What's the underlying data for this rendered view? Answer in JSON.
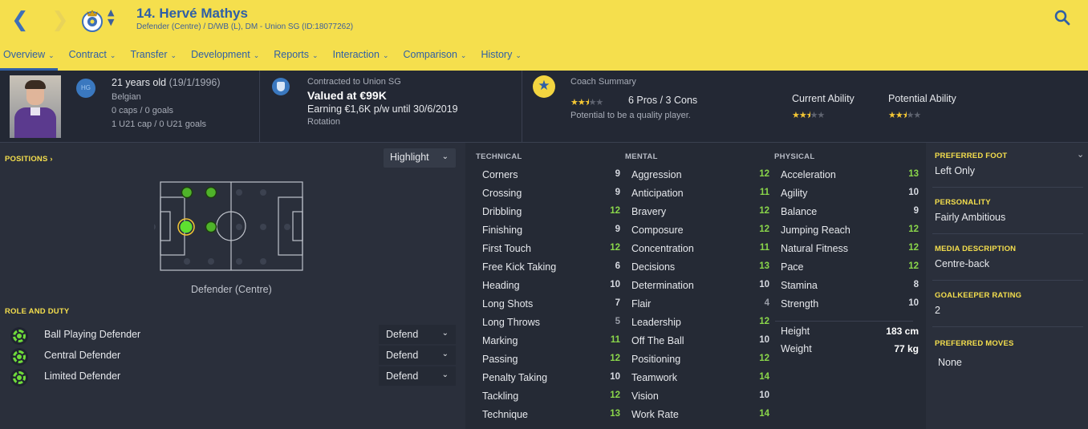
{
  "header": {
    "player_name": "14. Hervé Mathys",
    "player_subtitle": "Defender (Centre) / D/WB (L), DM - Union SG (ID:18077262)",
    "back_icon": "chevron-left-icon",
    "forward_icon": "chevron-right-icon",
    "search_icon": "search-icon",
    "accent_color": "#f5df4d",
    "text_color": "#2f5fa6"
  },
  "tabs": [
    {
      "label": "Overview",
      "active": true
    },
    {
      "label": "Contract"
    },
    {
      "label": "Transfer"
    },
    {
      "label": "Development"
    },
    {
      "label": "Reports"
    },
    {
      "label": "Interaction"
    },
    {
      "label": "Comparison"
    },
    {
      "label": "History"
    }
  ],
  "info": {
    "hg_badge": "HG",
    "age": "21 years old",
    "dob": "(19/1/1996)",
    "nationality": "Belgian",
    "caps": "0 caps / 0 goals",
    "u21_caps": "1 U21 cap / 0 U21 goals"
  },
  "contract": {
    "label": "Contracted to Union SG",
    "value": "Valued at €99K",
    "earning": "Earning €1,6K p/w until 30/6/2019",
    "status": "Rotation"
  },
  "coach": {
    "title": "Coach Summary",
    "rating_stars": 2.5,
    "pros_cons": "6 Pros / 3 Cons",
    "note": "Potential to be a quality player.",
    "current_ability_label": "Current Ability",
    "current_ability_stars": 2.5,
    "potential_ability_label": "Potential Ability",
    "potential_ability_stars": 2.5
  },
  "positions": {
    "title": "POSITIONS",
    "highlight_label": "Highlight",
    "position_label": "Defender (Centre)"
  },
  "roles": {
    "title": "ROLE AND DUTY",
    "items": [
      {
        "name": "Ball Playing Defender",
        "duty": "Defend"
      },
      {
        "name": "Central Defender",
        "duty": "Defend"
      },
      {
        "name": "Limited Defender",
        "duty": "Defend"
      }
    ]
  },
  "attributes": {
    "technical": {
      "title": "TECHNICAL",
      "items": [
        {
          "name": "Corners",
          "value": "9"
        },
        {
          "name": "Crossing",
          "value": "9"
        },
        {
          "name": "Dribbling",
          "value": "12"
        },
        {
          "name": "Finishing",
          "value": "9"
        },
        {
          "name": "First Touch",
          "value": "12"
        },
        {
          "name": "Free Kick Taking",
          "value": "6"
        },
        {
          "name": "Heading",
          "value": "10"
        },
        {
          "name": "Long Shots",
          "value": "7"
        },
        {
          "name": "Long Throws",
          "value": "5"
        },
        {
          "name": "Marking",
          "value": "11"
        },
        {
          "name": "Passing",
          "value": "12"
        },
        {
          "name": "Penalty Taking",
          "value": "10"
        },
        {
          "name": "Tackling",
          "value": "12"
        },
        {
          "name": "Technique",
          "value": "13"
        }
      ]
    },
    "mental": {
      "title": "MENTAL",
      "items": [
        {
          "name": "Aggression",
          "value": "12"
        },
        {
          "name": "Anticipation",
          "value": "11"
        },
        {
          "name": "Bravery",
          "value": "12"
        },
        {
          "name": "Composure",
          "value": "12"
        },
        {
          "name": "Concentration",
          "value": "11"
        },
        {
          "name": "Decisions",
          "value": "13"
        },
        {
          "name": "Determination",
          "value": "10"
        },
        {
          "name": "Flair",
          "value": "4"
        },
        {
          "name": "Leadership",
          "value": "12"
        },
        {
          "name": "Off The Ball",
          "value": "10"
        },
        {
          "name": "Positioning",
          "value": "12"
        },
        {
          "name": "Teamwork",
          "value": "14"
        },
        {
          "name": "Vision",
          "value": "10"
        },
        {
          "name": "Work Rate",
          "value": "14"
        }
      ]
    },
    "physical": {
      "title": "PHYSICAL",
      "items": [
        {
          "name": "Acceleration",
          "value": "13"
        },
        {
          "name": "Agility",
          "value": "10"
        },
        {
          "name": "Balance",
          "value": "9"
        },
        {
          "name": "Jumping Reach",
          "value": "12"
        },
        {
          "name": "Natural Fitness",
          "value": "12"
        },
        {
          "name": "Pace",
          "value": "12"
        },
        {
          "name": "Stamina",
          "value": "8"
        },
        {
          "name": "Strength",
          "value": "10"
        }
      ],
      "height_label": "Height",
      "height_value": "183 cm",
      "weight_label": "Weight",
      "weight_value": "77 kg"
    }
  },
  "details": [
    {
      "title": "PREFERRED FOOT",
      "value": "Left Only"
    },
    {
      "title": "PERSONALITY",
      "value": "Fairly Ambitious"
    },
    {
      "title": "MEDIA DESCRIPTION",
      "value": "Centre-back"
    },
    {
      "title": "GOALKEEPER RATING",
      "value": "2"
    },
    {
      "title": "PREFERRED MOVES",
      "value": "None"
    }
  ]
}
